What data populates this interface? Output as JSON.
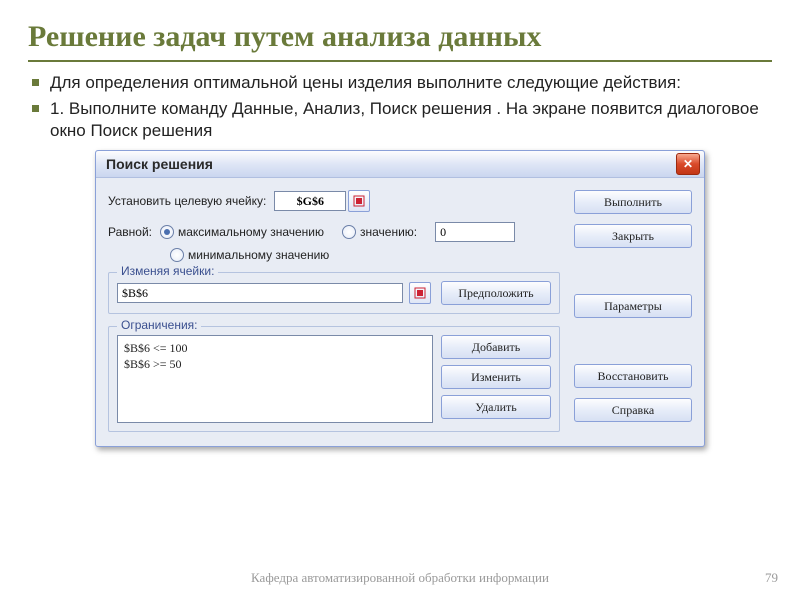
{
  "slide": {
    "title": "Решение задач путем анализа данных",
    "bullets": [
      "Для определения оптимальной цены изделия выполните следующие действия:",
      "1. Выполните команду Данные, Анализ, Поиск решения . На экране появится диалоговое окно Поиск решения"
    ],
    "footer": "Кафедра автоматизированной обработки информации",
    "page": "79"
  },
  "dialog": {
    "title": "Поиск решения",
    "target_label": "Установить целевую ячейку:",
    "target_value": "$G$6",
    "equal_label": "Равной:",
    "radios": {
      "max": "максимальному значению",
      "value": "значению:",
      "min": "минимальному значению"
    },
    "value_field": "0",
    "changing_group": "Изменяя ячейки:",
    "changing_value": "$B$6",
    "guess_btn": "Предположить",
    "constraints_group": "Ограничения:",
    "constraints": [
      "$B$6 <= 100",
      "$B$6 >= 50"
    ],
    "btns_left": {
      "add": "Добавить",
      "change": "Изменить",
      "delete": "Удалить"
    },
    "btns_right": {
      "run": "Выполнить",
      "close": "Закрыть",
      "params": "Параметры",
      "restore": "Восстановить",
      "help": "Справка"
    }
  }
}
